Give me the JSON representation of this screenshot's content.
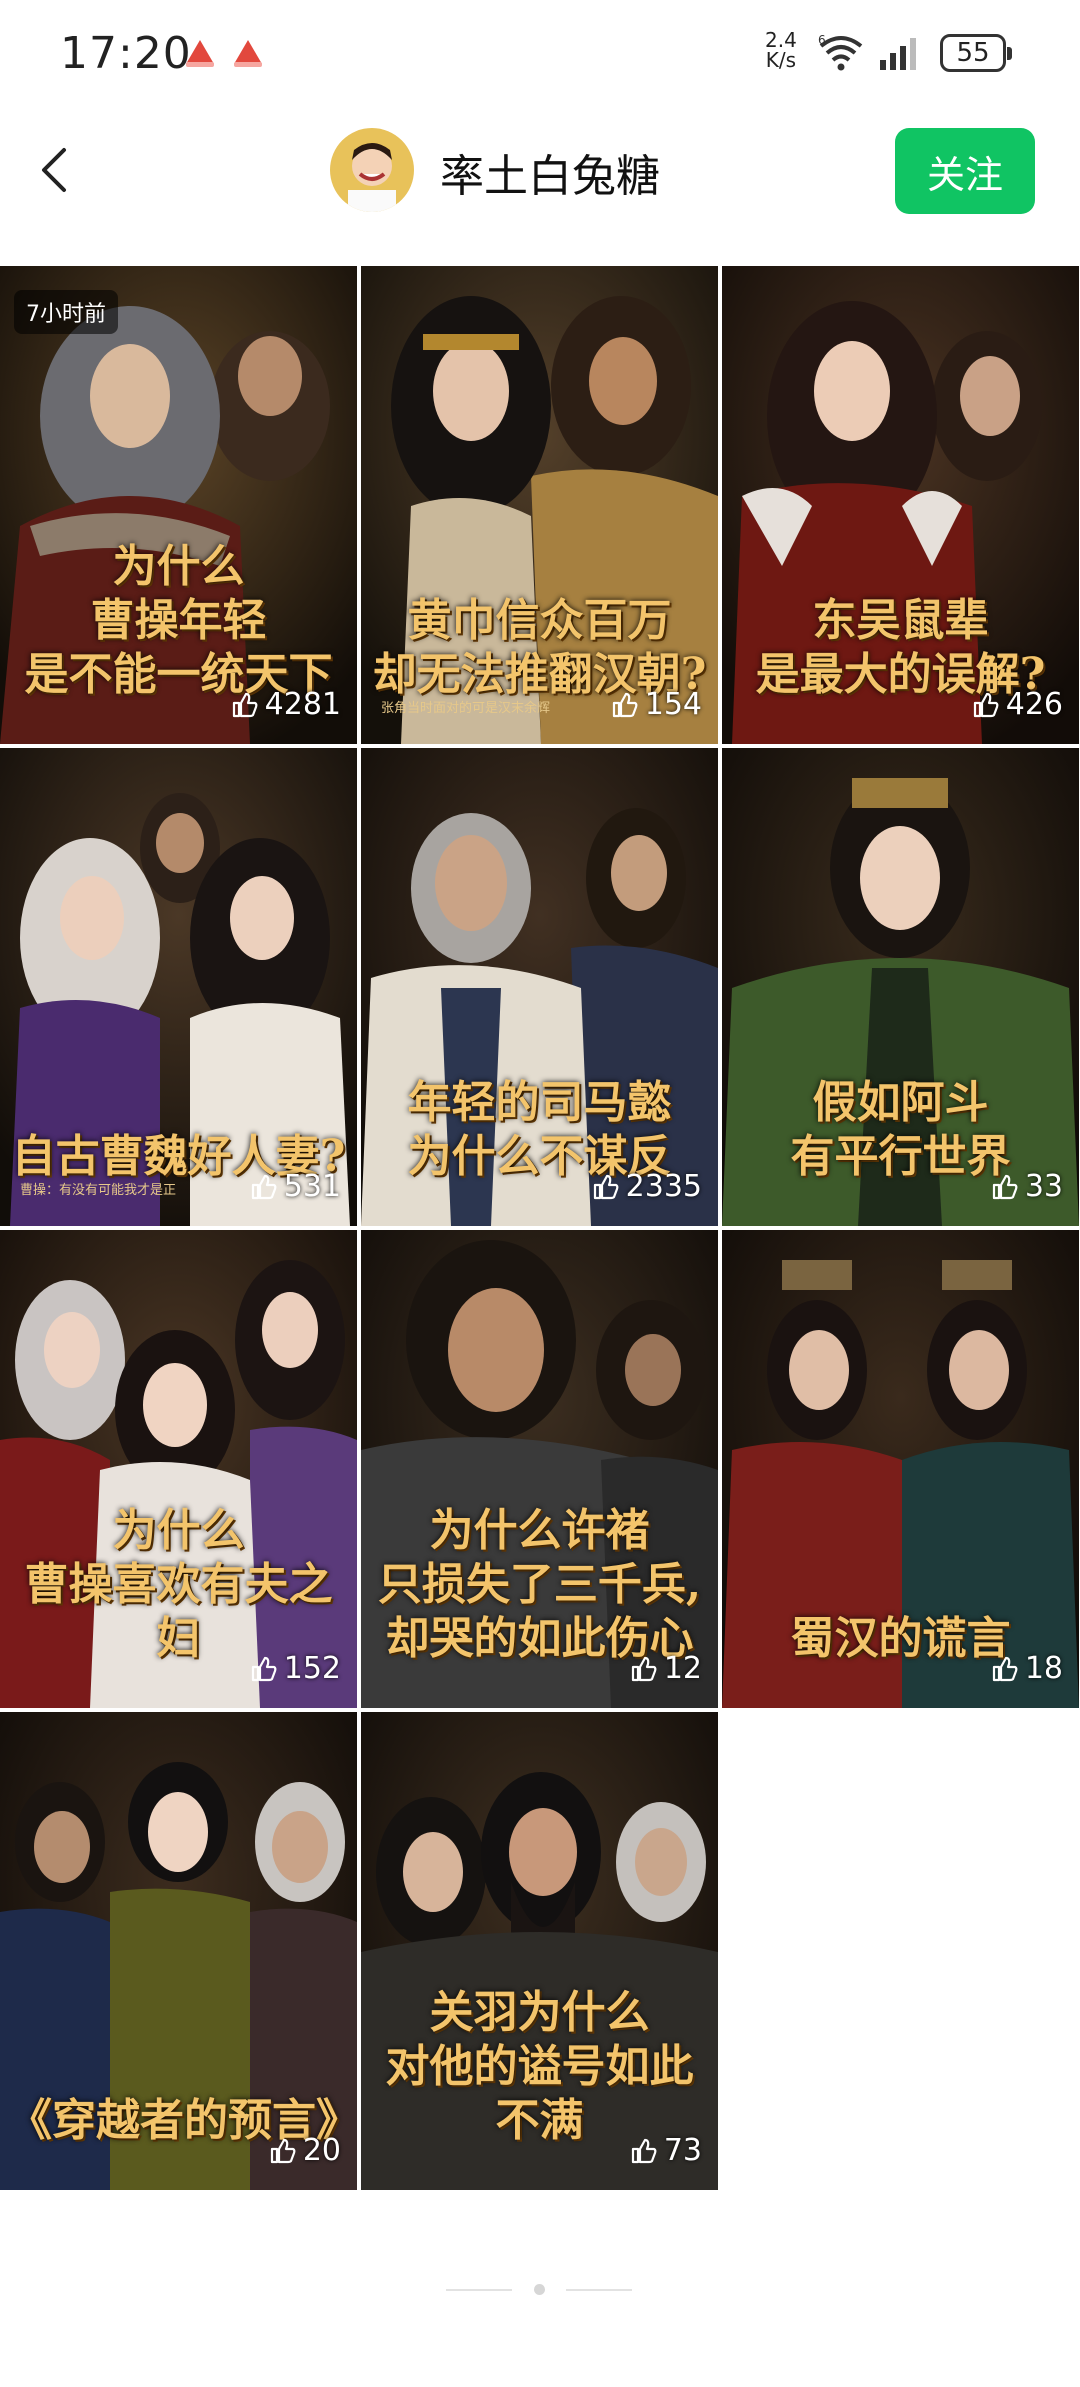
{
  "status_bar": {
    "time": "17:20",
    "net_speed_value": "2.4",
    "net_speed_unit": "K/s",
    "battery": "55",
    "icons": [
      "notification-icon",
      "notification-icon",
      "wifi-icon",
      "signal-icon",
      "battery-icon"
    ]
  },
  "header": {
    "back_icon": "chevron-left-icon",
    "username": "率土白兔糖",
    "follow_label": "关注",
    "accent": "#10c463"
  },
  "cards": [
    {
      "title": "为什么\n曹操年轻\n是不能一统天下",
      "likes": "4281",
      "badge": "7小时前",
      "subtitle": ""
    },
    {
      "title": "黄巾信众百万\n却无法推翻汉朝?",
      "likes": "154",
      "subtitle": "张角当时面对的可是汉末余辉"
    },
    {
      "title": "东吴鼠辈\n是最大的误解?",
      "likes": "426",
      "subtitle": ""
    },
    {
      "title": "自古曹魏好人妻?",
      "likes": "531",
      "subtitle": "曹操：有没有可能我才是正"
    },
    {
      "title": "年轻的司马懿\n为什么不谋反",
      "likes": "2335",
      "subtitle": ""
    },
    {
      "title": "假如阿斗\n有平行世界",
      "likes": "33",
      "subtitle": ""
    },
    {
      "title": "为什么\n曹操喜欢有夫之妇",
      "likes": "152",
      "subtitle": ""
    },
    {
      "title": "为什么许褚\n只损失了三千兵,\n却哭的如此伤心",
      "likes": "12",
      "subtitle": ""
    },
    {
      "title": "蜀汉的谎言",
      "likes": "18",
      "subtitle": ""
    },
    {
      "title": "《穿越者的预言》",
      "likes": "20",
      "subtitle": ""
    },
    {
      "title": "关羽为什么\n对他的谥号如此不满",
      "likes": "73",
      "subtitle": ""
    }
  ],
  "like_icon": "thumbs-up-icon",
  "pager": {
    "active_index": 1
  }
}
